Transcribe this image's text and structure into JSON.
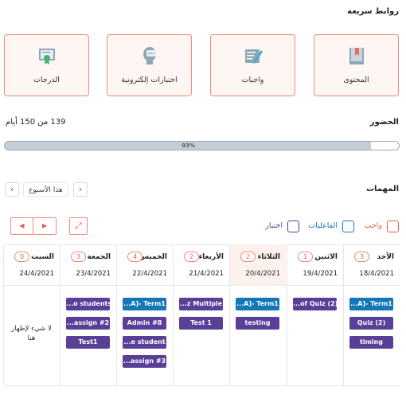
{
  "quick_links": {
    "title": "روابط سريعة",
    "cards": [
      {
        "label": "المحتوى",
        "icon": "book-icon"
      },
      {
        "label": "واجبات",
        "icon": "assignment-icon"
      },
      {
        "label": "اختبارات إلكترونية",
        "icon": "online-exam-icon"
      },
      {
        "label": "الدرجات",
        "icon": "grades-certificate-icon"
      }
    ]
  },
  "attendance": {
    "title": "الحضور",
    "summary": "139 من 150 أيام",
    "percent_label": "93%",
    "progress": 0.93
  },
  "tasks": {
    "title": "المهمات",
    "week_label": "هذا الأسبوع",
    "prev_symbol": "›",
    "next_symbol": "‹",
    "legend": [
      {
        "label": "واجب",
        "color": "#e0614d"
      },
      {
        "label": "الفاعليات",
        "color": "#1577b5"
      },
      {
        "label": "اختبار",
        "color": "#5a3f99"
      }
    ],
    "controls": {
      "prev": "◀",
      "next": "▶",
      "expand": "⤢"
    },
    "days": [
      {
        "name": "الأحد",
        "count": "3",
        "date": "18/4/2021",
        "items": [
          {
            "text": "...A]- Term1",
            "kind": "quiz"
          },
          {
            "text": "Quiz (2)",
            "kind": "hw"
          },
          {
            "text": "timing",
            "kind": "hw"
          }
        ]
      },
      {
        "name": "الاثنين",
        "count": "1",
        "date": "19/4/2021",
        "items": [
          {
            "text": "...of Quiz (2)",
            "kind": "hw"
          }
        ]
      },
      {
        "name": "الثلاثاء",
        "count": "2",
        "date": "20/4/2021",
        "items": [
          {
            "text": "...A]- Term1",
            "kind": "quiz"
          },
          {
            "text": "testing",
            "kind": "hw"
          }
        ]
      },
      {
        "name": "الأربعاء",
        "count": "2",
        "date": "21/4/2021",
        "items": [
          {
            "text": "...z Multiple",
            "kind": "hw"
          },
          {
            "text": "Test 1",
            "kind": "hw"
          }
        ]
      },
      {
        "name": "الخميس",
        "count": "4",
        "date": "22/4/2021",
        "items": [
          {
            "text": "...A]- Term1",
            "kind": "quiz"
          },
          {
            "text": "Admin #8",
            "kind": "hw"
          },
          {
            "text": "...e student",
            "kind": "hw"
          },
          {
            "text": "...assign #3",
            "kind": "hw"
          }
        ]
      },
      {
        "name": "الجمعة",
        "count": "3",
        "date": "23/4/2021",
        "items": [
          {
            "text": "...o students",
            "kind": "hw"
          },
          {
            "text": "...assign #2",
            "kind": "hw"
          },
          {
            "text": "Test1",
            "kind": "hw"
          }
        ]
      },
      {
        "name": "السبت",
        "count": "0",
        "date": "24/4/2021",
        "items": [],
        "empty_text": "لا شيء لإظهار هنا"
      }
    ]
  }
}
